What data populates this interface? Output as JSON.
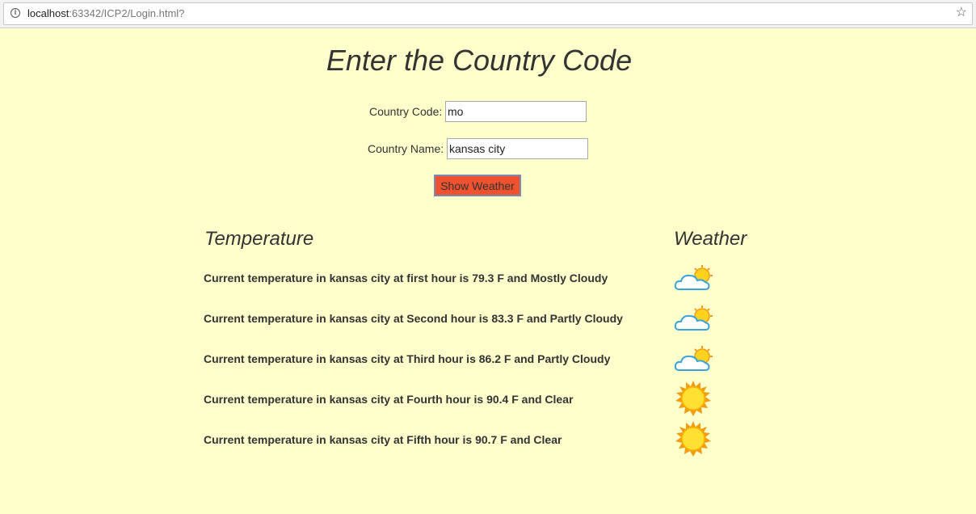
{
  "browser": {
    "url_host": "localhost",
    "url_rest": ":63342/ICP2/Login.html?"
  },
  "page": {
    "title": "Enter the Country Code"
  },
  "form": {
    "country_code_label": "Country Code:",
    "country_code_value": "mo",
    "country_name_label": "Country Name:",
    "country_name_value": "kansas city",
    "submit_label": "Show Weather"
  },
  "results": {
    "temperature_heading": "Temperature",
    "weather_heading": "Weather",
    "rows": [
      {
        "text": "Current temperature in kansas city at first hour is 79.3 F and Mostly Cloudy",
        "icon": "partly-cloudy-icon"
      },
      {
        "text": "Current temperature in kansas city at Second hour is 83.3 F and Partly Cloudy",
        "icon": "partly-cloudy-icon"
      },
      {
        "text": "Current temperature in kansas city at Third hour is 86.2 F and Partly Cloudy",
        "icon": "partly-cloudy-icon"
      },
      {
        "text": "Current temperature in kansas city at Fourth hour is 90.4 F and Clear",
        "icon": "sun-icon"
      },
      {
        "text": "Current temperature in kansas city at Fifth hour is 90.7 F and Clear",
        "icon": "sun-icon"
      }
    ]
  },
  "colors": {
    "page_background": "#ffffcc",
    "button_background": "#f0522f",
    "text": "#333333"
  }
}
